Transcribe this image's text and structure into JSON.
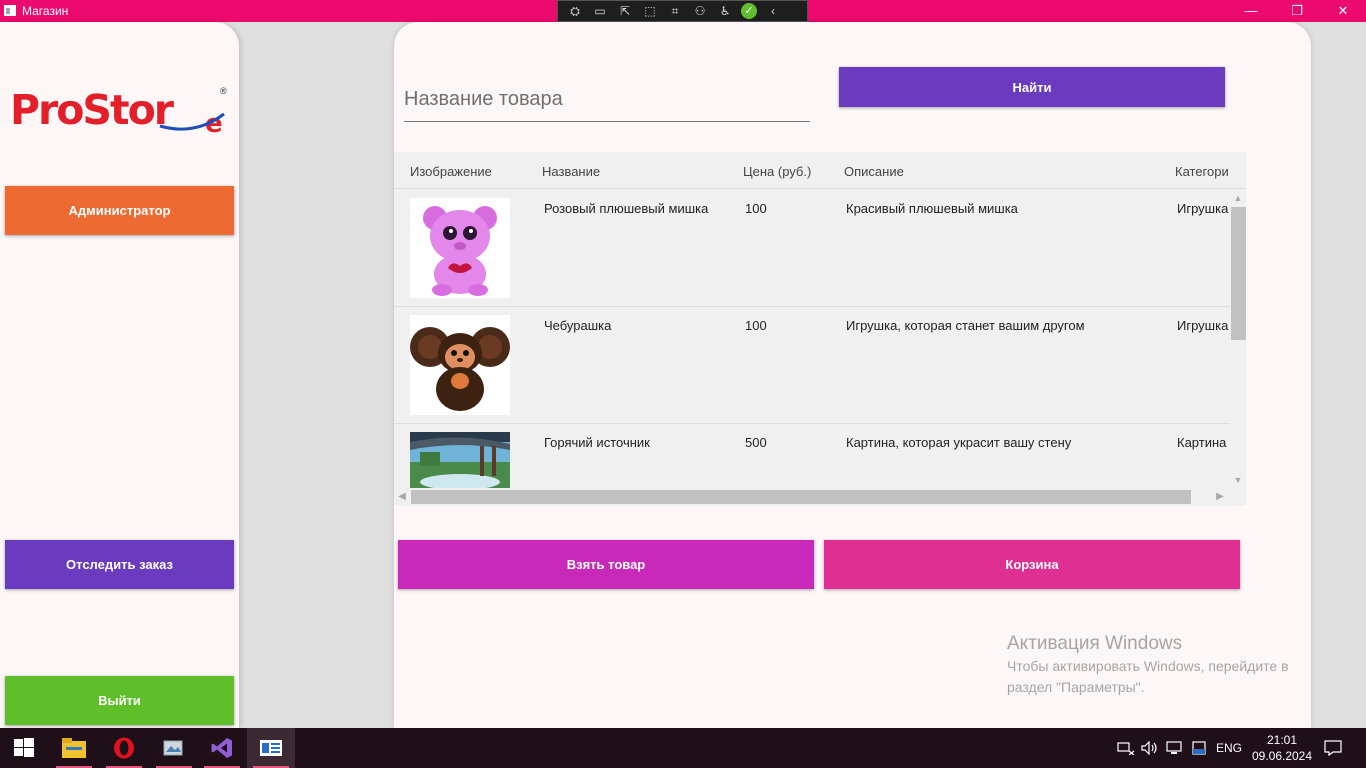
{
  "window": {
    "title": "Магазин",
    "controls": {
      "minimize": "—",
      "maximize": "❐",
      "close": "✕"
    },
    "accent": "#ec0a6e"
  },
  "devtools": [
    "⛭",
    "▭",
    "⇱",
    "⬚",
    "⌗",
    "⚇",
    "♿",
    "✓",
    "‹"
  ],
  "sidebar": {
    "logo_text": "ProStore",
    "logo_reg": "®",
    "admin_button": "Администратор",
    "track_button": "Отследить заказ",
    "exit_button": "Выйти",
    "colors": {
      "admin": "#ee6a33",
      "track": "#6a3bbf",
      "exit": "#5fbf2a"
    }
  },
  "search": {
    "placeholder": "Название товара",
    "find_button": "Найти"
  },
  "grid": {
    "columns": [
      "Изображение",
      "Название",
      "Цена (руб.)",
      "Описание",
      "Категори"
    ],
    "rows": [
      {
        "name": "Розовый плюшевый мишка",
        "price": "100",
        "description": "Красивый плюшевый мишка",
        "category": "Игрушка",
        "image": "pink-teddy-bear"
      },
      {
        "name": "Чебурашка",
        "price": "100",
        "description": "Игрушка, которая станет вашим другом",
        "category": "Игрушка",
        "image": "cheburashka"
      },
      {
        "name": "Горячий источник",
        "price": "500",
        "description": "Картина, которая украсит вашу стену",
        "category": "Картина",
        "image": "hot-spring-painting"
      }
    ]
  },
  "actions": {
    "take_button": "Взять товар",
    "cart_button": "Корзина",
    "colors": {
      "take": "#c829b8",
      "cart": "#df2f92"
    }
  },
  "watermark": {
    "title": "Активация Windows",
    "line1": "Чтобы активировать Windows, перейдите в",
    "line2": "раздел \"Параметры\"."
  },
  "taskbar": {
    "apps": [
      "start-icon",
      "file-explorer-icon",
      "opera-icon",
      "photos-icon",
      "visual-studio-icon",
      "store-app-icon"
    ],
    "lang": "ENG",
    "time": "21:01",
    "date": "09.06.2024"
  }
}
